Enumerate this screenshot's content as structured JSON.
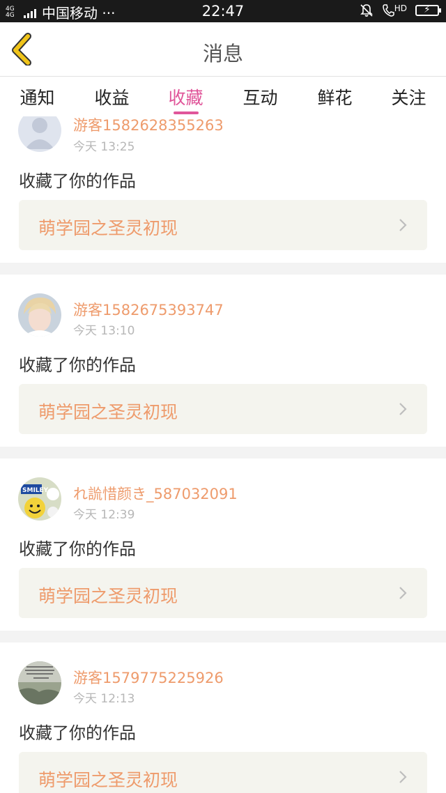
{
  "status_bar": {
    "network_type": "4G 4G",
    "carrier": "中国移动 ···",
    "time": "22:47",
    "hd_label": "HD",
    "icons": [
      "signal-icon",
      "mute-bell-icon",
      "call-hd-icon",
      "battery-charging-icon"
    ]
  },
  "header": {
    "back_icon": "chevron-left-icon",
    "title": "消息",
    "accent_color": "#f0c419"
  },
  "tabs": [
    {
      "label": "通知",
      "active": false
    },
    {
      "label": "收益",
      "active": false
    },
    {
      "label": "收藏",
      "active": true
    },
    {
      "label": "互动",
      "active": false
    },
    {
      "label": "鲜花",
      "active": false
    },
    {
      "label": "关注",
      "active": false
    }
  ],
  "active_tab_color": "#e0569a",
  "messages": [
    {
      "user": "游客1582628355263",
      "time": "今天 13:25",
      "action": "收藏了你的作品",
      "work_title": "萌学园之圣灵初现",
      "avatar": "default-person-avatar"
    },
    {
      "user": "游客1582675393747",
      "time": "今天 13:10",
      "action": "收藏了你的作品",
      "work_title": "萌学园之圣灵初现",
      "avatar": "blond-boy-avatar"
    },
    {
      "user": "れ詤惜颜き_587032091",
      "time": "今天 12:39",
      "action": "收藏了你的作品",
      "work_title": "萌学园之圣灵初现",
      "avatar": "smiley-sticker-avatar"
    },
    {
      "user": "游客1579775225926",
      "time": "今天 12:13",
      "action": "收藏了你的作品",
      "work_title": "萌学园之圣灵初现",
      "avatar": "text-image-avatar"
    }
  ],
  "colors": {
    "username": "#ee9b6c",
    "work_title": "#ee9b6c",
    "timestamp": "#b7b7b7",
    "work_box_bg": "#f4f4ee",
    "divider": "#f3f3f3"
  }
}
